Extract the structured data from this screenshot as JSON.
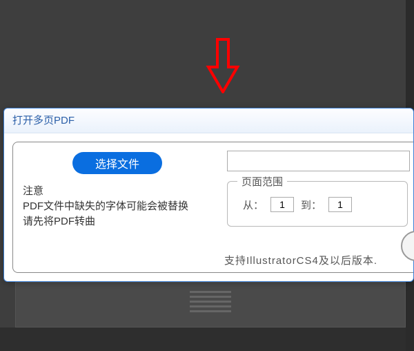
{
  "dialog": {
    "title": "打开多页PDF",
    "select_file_label": "选择文件",
    "path_value": "",
    "notice": {
      "heading": "注意",
      "line1": "PDF文件中缺失的字体可能会被替换",
      "line2": "请先将PDF转曲"
    },
    "range": {
      "legend": "页面范围",
      "from_label": "从：",
      "from_value": "1",
      "to_label": "到：",
      "to_value": "1"
    },
    "footer": "支持IllustratorCS4及以后版本."
  },
  "annotation": {
    "arrow": "down-arrow"
  }
}
